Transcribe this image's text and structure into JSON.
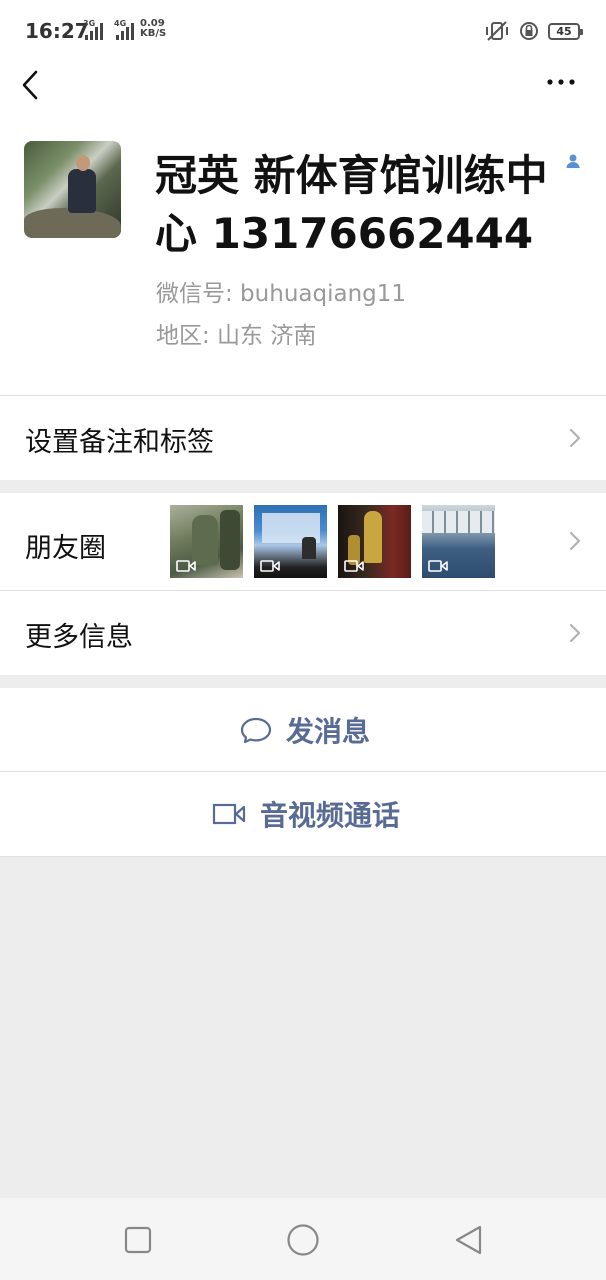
{
  "status_bar": {
    "time": "16:27",
    "net1": "3G",
    "net2": "4G",
    "speed_value": "0.09",
    "speed_unit": "KB/S",
    "battery": "45"
  },
  "profile": {
    "name": "冠英 新体育馆训练中心 13176662444",
    "wechat_id": "微信号: buhuaqiang11",
    "region": "地区: 山东  济南"
  },
  "menu": {
    "remark_label": "设置备注和标签",
    "moments_label": "朋友圈",
    "more_info_label": "更多信息"
  },
  "actions": {
    "send_message": "发消息",
    "video_call": "音视频通话"
  },
  "colors": {
    "link_blue": "#576b95",
    "background": "#ededed"
  },
  "icons": {
    "back": "chevron-left-icon",
    "more": "ellipsis-icon",
    "contact_tag": "person-icon",
    "chat": "chat-bubble-icon",
    "video": "video-camera-icon"
  }
}
